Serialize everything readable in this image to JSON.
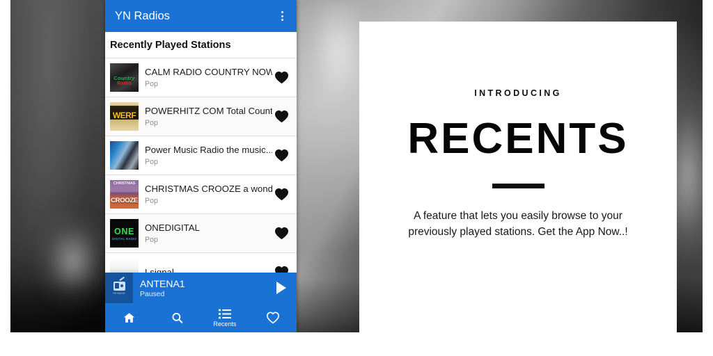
{
  "app": {
    "title": "YN Radios",
    "overflow_icon": "overflow-menu-icon",
    "section_title": "Recently Played Stations",
    "accent_color": "#1a73d4",
    "dark_accent_color": "#15539c"
  },
  "stations": [
    {
      "name": "CALM RADIO COUNTRY NOW...",
      "genre": "Pop",
      "art": "country",
      "art_text_1": "Country",
      "art_text_2": "Radio",
      "favorite_icon": "heart-filled-icon"
    },
    {
      "name": "POWERHITZ COM Total Count...",
      "genre": "Pop",
      "art": "werf",
      "art_text_1": "WERF",
      "art_text_2": "",
      "favorite_icon": "heart-filled-icon"
    },
    {
      "name": "Power Music Radio the music...",
      "genre": "Pop",
      "art": "power",
      "art_text_1": "",
      "art_text_2": "",
      "favorite_icon": "heart-filled-icon"
    },
    {
      "name": "CHRISTMAS CROOZE a wond...",
      "genre": "Pop",
      "art": "crooze",
      "art_text_1": "CHRISTMAS",
      "art_text_2": "CROOZE",
      "favorite_icon": "heart-filled-icon"
    },
    {
      "name": "ONEDIGITAL",
      "genre": "Pop",
      "art": "one",
      "art_text_1": "ONE",
      "art_text_2": "DIGITAL RADIO",
      "favorite_icon": "heart-filled-icon"
    },
    {
      "name": "Lsignal",
      "genre": "",
      "art": "blank",
      "art_text_1": "",
      "art_text_2": "",
      "favorite_icon": "heart-filled-icon"
    }
  ],
  "now_playing": {
    "station": "ANTENA1",
    "status": "Paused",
    "thumb_caption": "FM RADIO",
    "thumb_icon": "radio-icon",
    "play_icon": "play-icon"
  },
  "bottom_nav": [
    {
      "label": "",
      "icon": "home-icon",
      "active": false
    },
    {
      "label": "",
      "icon": "search-icon",
      "active": false
    },
    {
      "label": "Recents",
      "icon": "list-icon",
      "active": true
    },
    {
      "label": "",
      "icon": "heart-outline-icon",
      "active": false
    }
  ],
  "promo": {
    "kicker": "INTRODUCING",
    "title": "RECENTS",
    "body": "A feature that lets you easily browse to your previously played stations. Get the App Now..!"
  }
}
